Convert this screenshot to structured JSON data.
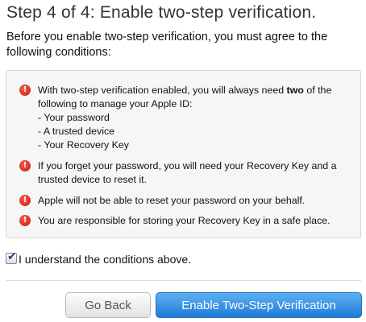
{
  "header": {
    "title": "Step 4 of 4: Enable two-step verification.",
    "intro": "Before you enable two-step verification, you must agree to the following conditions:"
  },
  "conditions": {
    "c1_before": "With two-step verification enabled, you will always need ",
    "c1_bold": "two",
    "c1_after": " of the following to manage your Apple ID:",
    "c1_items": [
      "- Your password",
      "- A trusted device",
      "- Your Recovery Key"
    ],
    "c2": "If you forget your password, you will need your Recovery Key and a trusted device to reset it.",
    "c3": "Apple will not be able to reset your password on your behalf.",
    "c4": "You are responsible for storing your Recovery Key in a safe place."
  },
  "agreement": {
    "label": "I understand the conditions above.",
    "checked": true
  },
  "buttons": {
    "back": "Go Back",
    "enable": "Enable Two-Step Verification"
  },
  "colors": {
    "warning_icon": "#d8261a",
    "primary_button": "#2f8ae5"
  },
  "icons": {
    "warning": "exclamation-circle"
  }
}
